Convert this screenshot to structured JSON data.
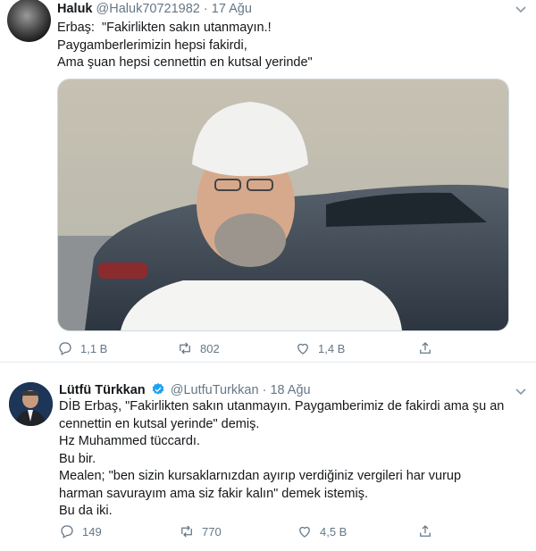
{
  "tweets": [
    {
      "name": "Haluk",
      "handle": "@Haluk70721982",
      "separator": "·",
      "date": "17 Ağu",
      "lines": [
        "Erbaş:  \"Fakirlikten sakın utanmayın.!",
        "Paygamberlerimizin hepsi fakirdi,",
        "Ama şuan hepsi cennettin en kutsal yerinde\""
      ],
      "replies": "1,1 B",
      "retweets": "802",
      "likes": "1,4 B"
    },
    {
      "name": "Lütfü Türkkan",
      "handle": "@LutfuTurkkan",
      "separator": "·",
      "date": "18 Ağu",
      "lines": [
        "DİB Erbaş, \"Fakirlikten sakın utanmayın. Paygamberimiz de fakirdi ama şu an",
        "cennettin en kutsal yerinde\" demiş.",
        "Hz Muhammed tüccardı.",
        "Bu bir.",
        "Mealen; \"ben sizin kursaklarnızdan ayırıp verdiğiniz vergileri har vurup",
        "harman savurayım ama siz fakir kalın\" demek istemiş.",
        "Bu da iki."
      ],
      "replies": "149",
      "retweets": "770",
      "likes": "4,5 B"
    }
  ],
  "colors": {
    "text": "#14171a",
    "secondary": "#657786",
    "verified": "#1da1f2",
    "divider": "#e6ecf0"
  },
  "icons": [
    "reply-icon",
    "retweet-icon",
    "like-icon",
    "share-icon",
    "chevron-down-icon",
    "verified-badge-icon"
  ]
}
